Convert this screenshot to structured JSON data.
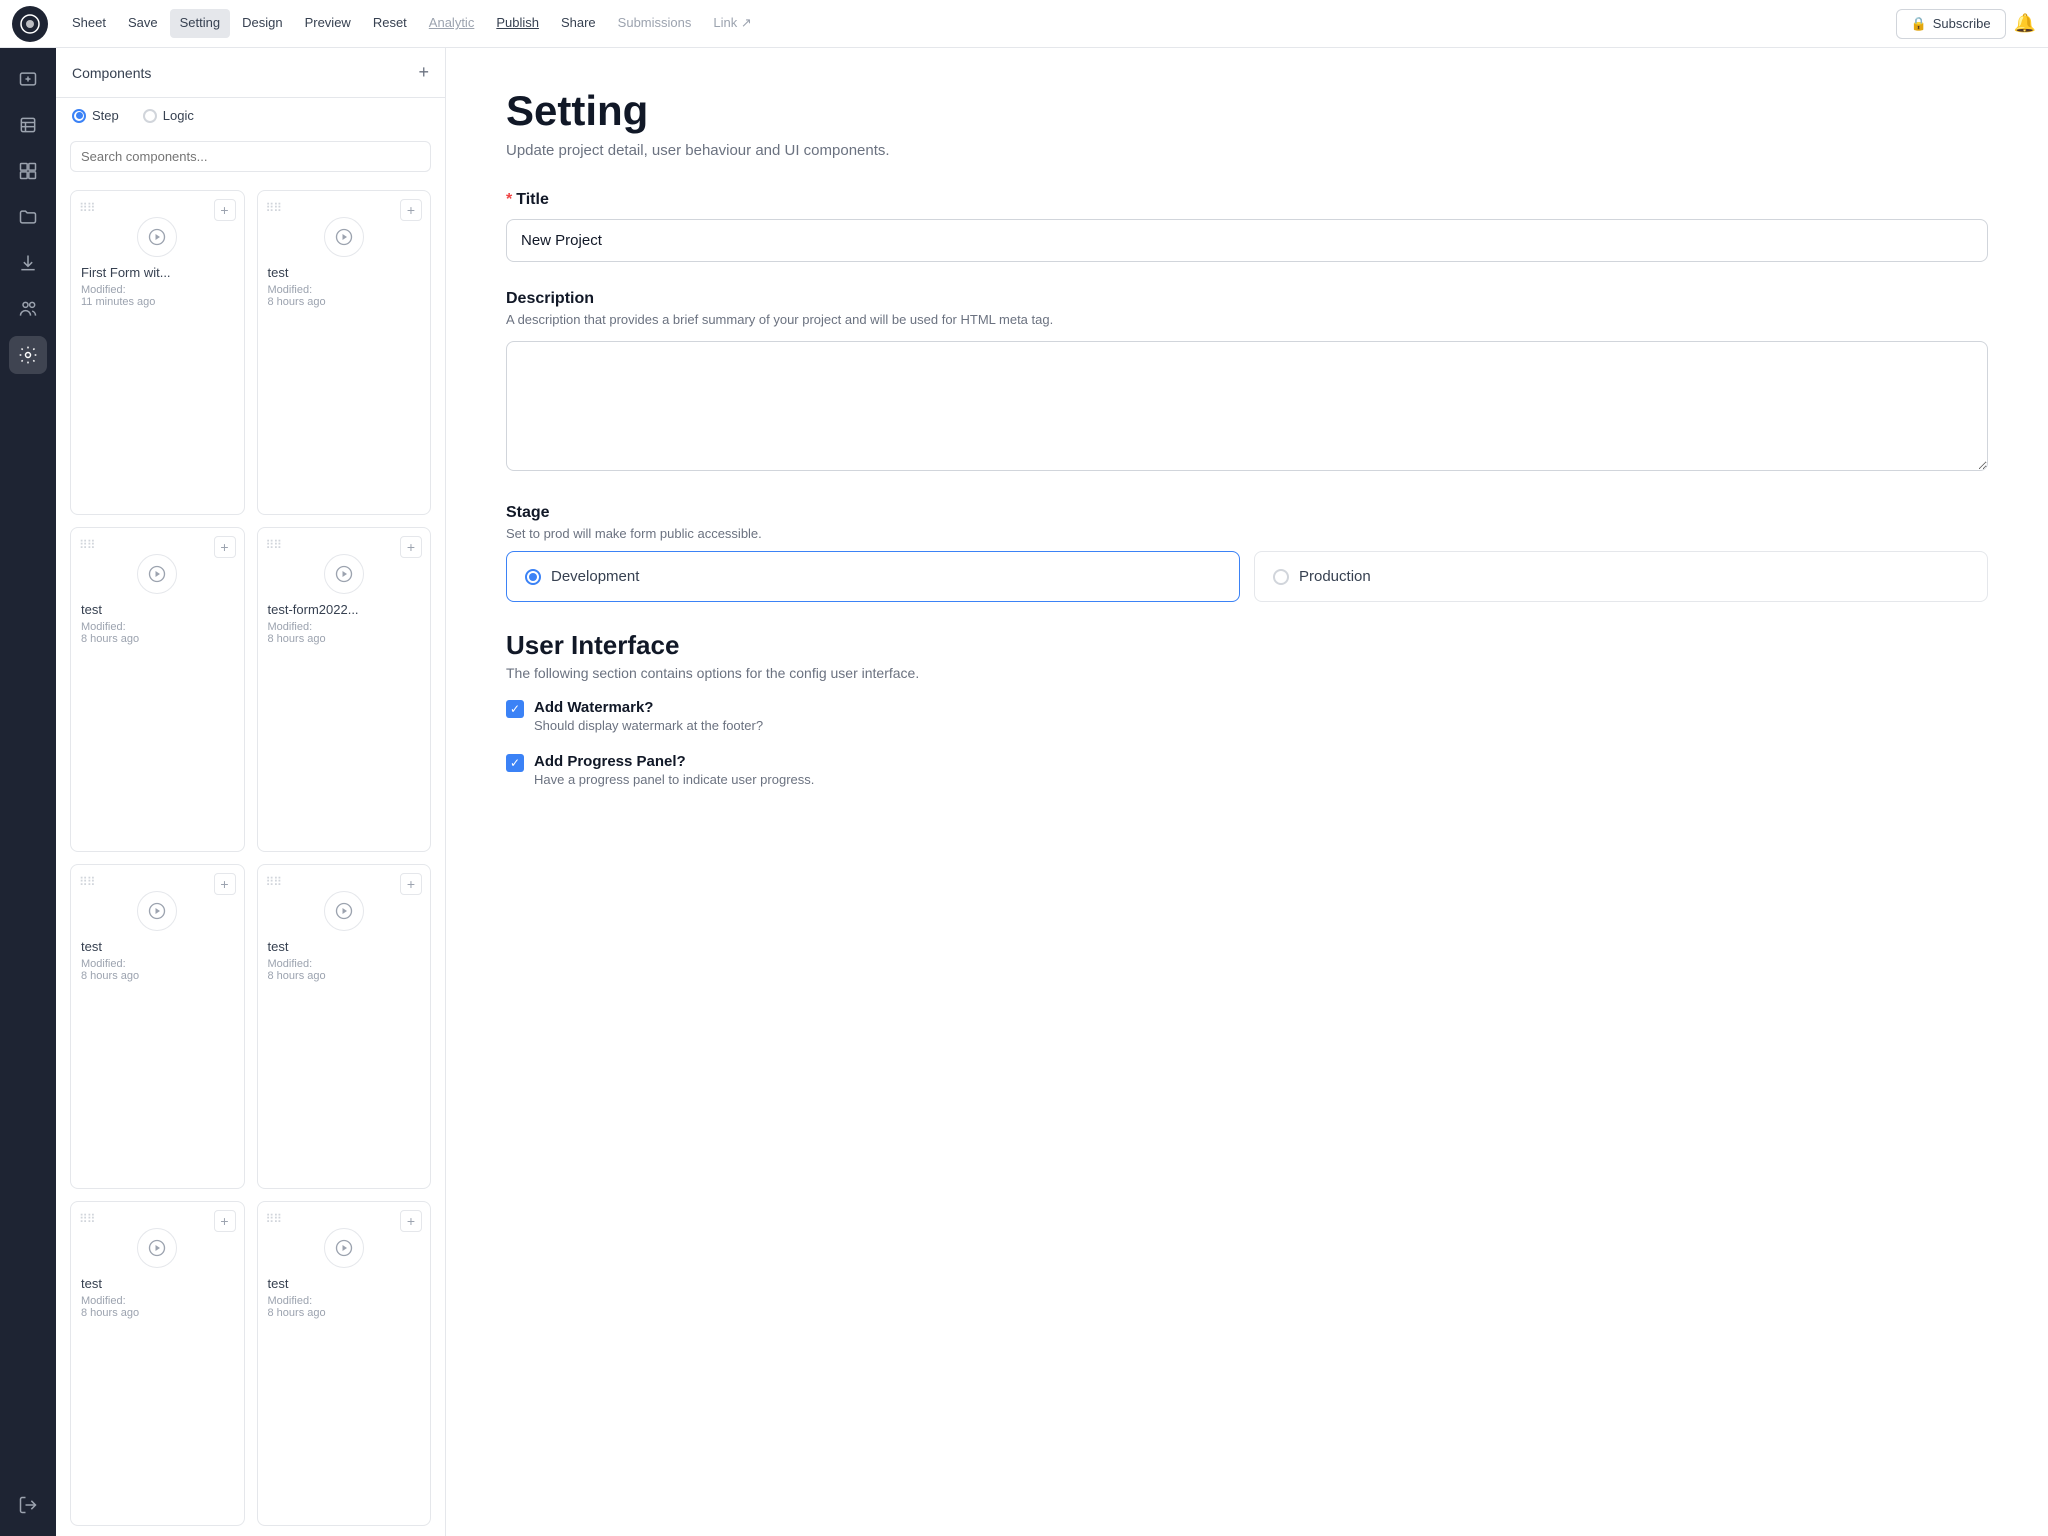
{
  "nav": {
    "logo_icon": "◉",
    "items": [
      {
        "id": "sheet",
        "label": "Sheet",
        "active": false,
        "muted": false
      },
      {
        "id": "save",
        "label": "Save",
        "active": false,
        "muted": false
      },
      {
        "id": "setting",
        "label": "Setting",
        "active": true,
        "muted": false
      },
      {
        "id": "design",
        "label": "Design",
        "active": false,
        "muted": false
      },
      {
        "id": "preview",
        "label": "Preview",
        "active": false,
        "muted": false
      },
      {
        "id": "reset",
        "label": "Reset",
        "active": false,
        "muted": false
      },
      {
        "id": "analytic",
        "label": "Analytic",
        "active": false,
        "muted": true,
        "underline": true
      },
      {
        "id": "publish",
        "label": "Publish",
        "active": false,
        "muted": false,
        "underline": true
      },
      {
        "id": "share",
        "label": "Share",
        "active": false,
        "muted": false
      },
      {
        "id": "submissions",
        "label": "Submissions",
        "active": false,
        "muted": true
      },
      {
        "id": "link",
        "label": "Link ↗",
        "active": false,
        "muted": true
      }
    ],
    "subscribe_label": "Subscribe",
    "lock_icon": "🔒"
  },
  "sidebar": {
    "icons": [
      {
        "id": "add-form",
        "icon": "⊕",
        "active": false
      },
      {
        "id": "layers",
        "icon": "⊞",
        "active": false
      },
      {
        "id": "components",
        "icon": "⊟",
        "active": false
      },
      {
        "id": "folder",
        "icon": "📁",
        "active": false
      },
      {
        "id": "download",
        "icon": "⬇",
        "active": false
      },
      {
        "id": "users",
        "icon": "👥",
        "active": false
      },
      {
        "id": "settings",
        "icon": "⚙",
        "active": true
      },
      {
        "id": "logout",
        "icon": "↩",
        "active": false,
        "bottom": true
      }
    ]
  },
  "components_panel": {
    "title": "Components",
    "add_icon": "+",
    "tabs": [
      {
        "id": "step",
        "label": "Step",
        "checked": true
      },
      {
        "id": "logic",
        "label": "Logic",
        "checked": false
      }
    ],
    "search_placeholder": "Search components...",
    "cards": [
      {
        "id": "c1",
        "name": "First Form wit...",
        "modified_label": "Modified:",
        "time": "11 minutes ago"
      },
      {
        "id": "c2",
        "name": "test",
        "modified_label": "Modified:",
        "time": "8 hours ago"
      },
      {
        "id": "c3",
        "name": "test",
        "modified_label": "Modified:",
        "time": "8 hours ago"
      },
      {
        "id": "c4",
        "name": "test-form2022...",
        "modified_label": "Modified:",
        "time": "8 hours ago"
      },
      {
        "id": "c5",
        "name": "test",
        "modified_label": "Modified:",
        "time": "8 hours ago"
      },
      {
        "id": "c6",
        "name": "test",
        "modified_label": "Modified:",
        "time": "8 hours ago"
      },
      {
        "id": "c7",
        "name": "test",
        "modified_label": "Modified:",
        "time": "8 hours ago"
      },
      {
        "id": "c8",
        "name": "test",
        "modified_label": "Modified:",
        "time": "8 hours ago"
      }
    ]
  },
  "setting_page": {
    "title": "Setting",
    "subtitle": "Update project detail, user behaviour and UI components.",
    "title_field": {
      "label": "Title",
      "required": true,
      "value": "New Project"
    },
    "description_field": {
      "label": "Description",
      "hint": "A description that provides a brief summary of your project and will be used for HTML meta tag.",
      "value": ""
    },
    "stage_field": {
      "label": "Stage",
      "hint": "Set to prod will make form public accessible.",
      "options": [
        {
          "id": "development",
          "label": "Development",
          "selected": true
        },
        {
          "id": "production",
          "label": "Production",
          "selected": false
        }
      ]
    },
    "user_interface": {
      "title": "User Interface",
      "subtitle": "The following section contains options for the config user interface.",
      "checkboxes": [
        {
          "id": "watermark",
          "label": "Add Watermark?",
          "description": "Should display watermark at the footer?",
          "checked": true
        },
        {
          "id": "progress",
          "label": "Add Progress Panel?",
          "description": "Have a progress panel to indicate user progress.",
          "checked": true
        }
      ]
    }
  }
}
